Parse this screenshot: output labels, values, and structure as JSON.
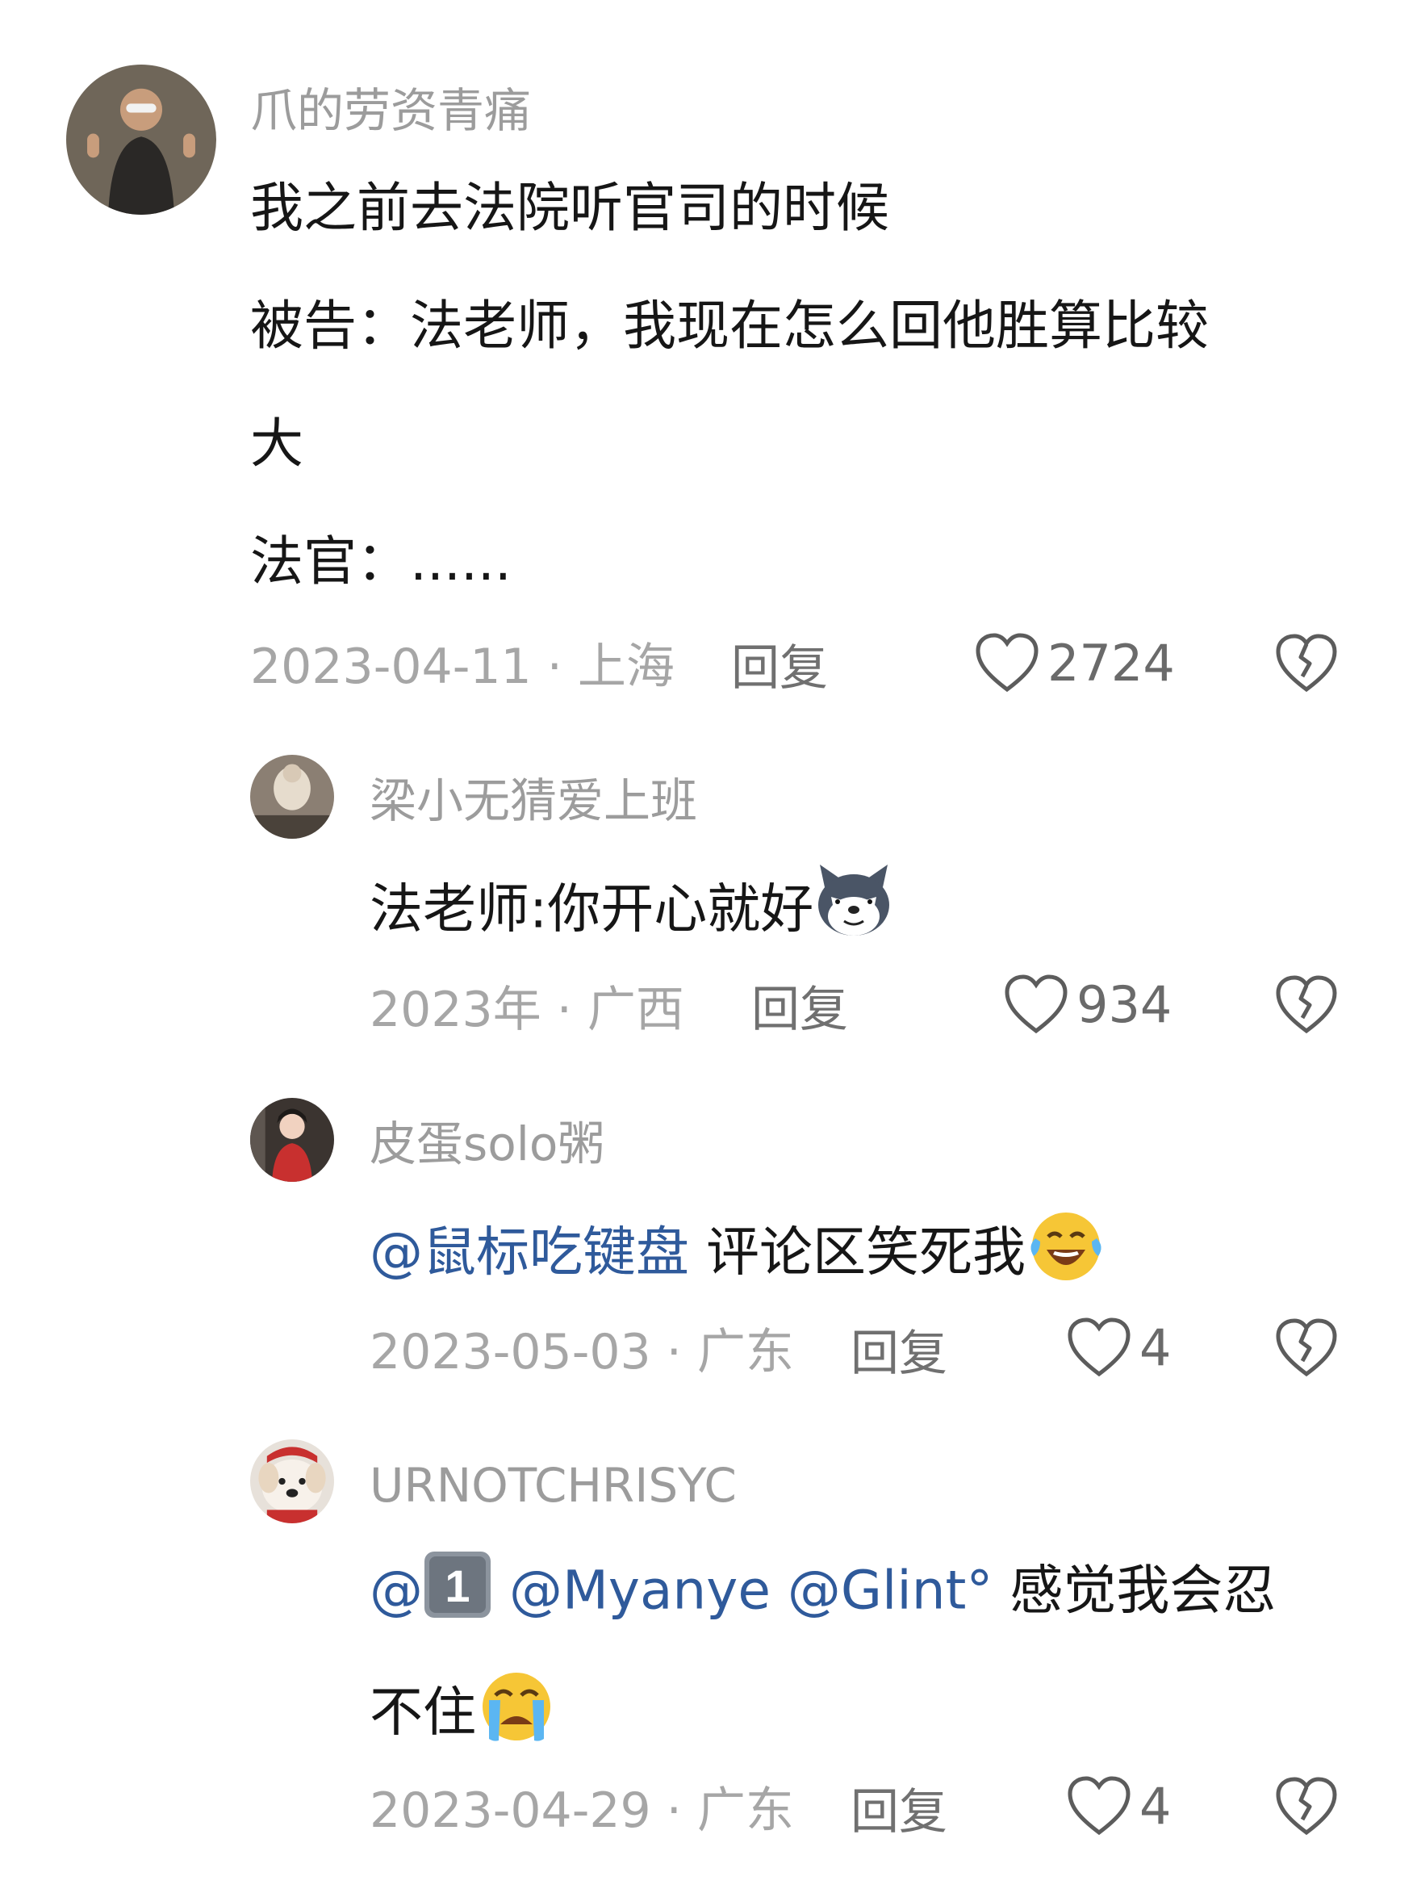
{
  "comments": [
    {
      "username": "爪的劳资青痛",
      "lines": [
        "我之前去法院听官司的时候",
        "被告：法老师，我现在怎么回他胜算比较",
        "大",
        "法官：......"
      ],
      "meta": "2023-04-11 · 上海",
      "reply_label": "回复",
      "likes": "2724"
    },
    {
      "username": "梁小无猜爱上班",
      "text": "法老师:你开心就好",
      "emoji": "doge-wolf-emoji",
      "meta": "2023年 · 广西",
      "reply_label": "回复",
      "likes": "934"
    },
    {
      "username": "皮蛋solo粥",
      "mention": "@鼠标吃键盘",
      "text": " 评论区笑死我",
      "emoji": "laugh-cry-emoji",
      "meta": "2023-05-03 · 广东",
      "reply_label": "回复",
      "likes": "4"
    },
    {
      "username": "URNOTCHRISYC",
      "mention_1": "@",
      "keycap": "1",
      "mention_2": " @Myanye @Glint°",
      "text_1": " 感觉我会忍",
      "text_2": "不住",
      "emoji": "crying-emoji",
      "meta": "2023-04-29 · 广东",
      "reply_label": "回复",
      "likes": "4"
    }
  ],
  "colors": {
    "text": "#161616",
    "username": "#9c9c9c",
    "meta": "#a6a6a6",
    "mention": "#2f5a9b"
  }
}
